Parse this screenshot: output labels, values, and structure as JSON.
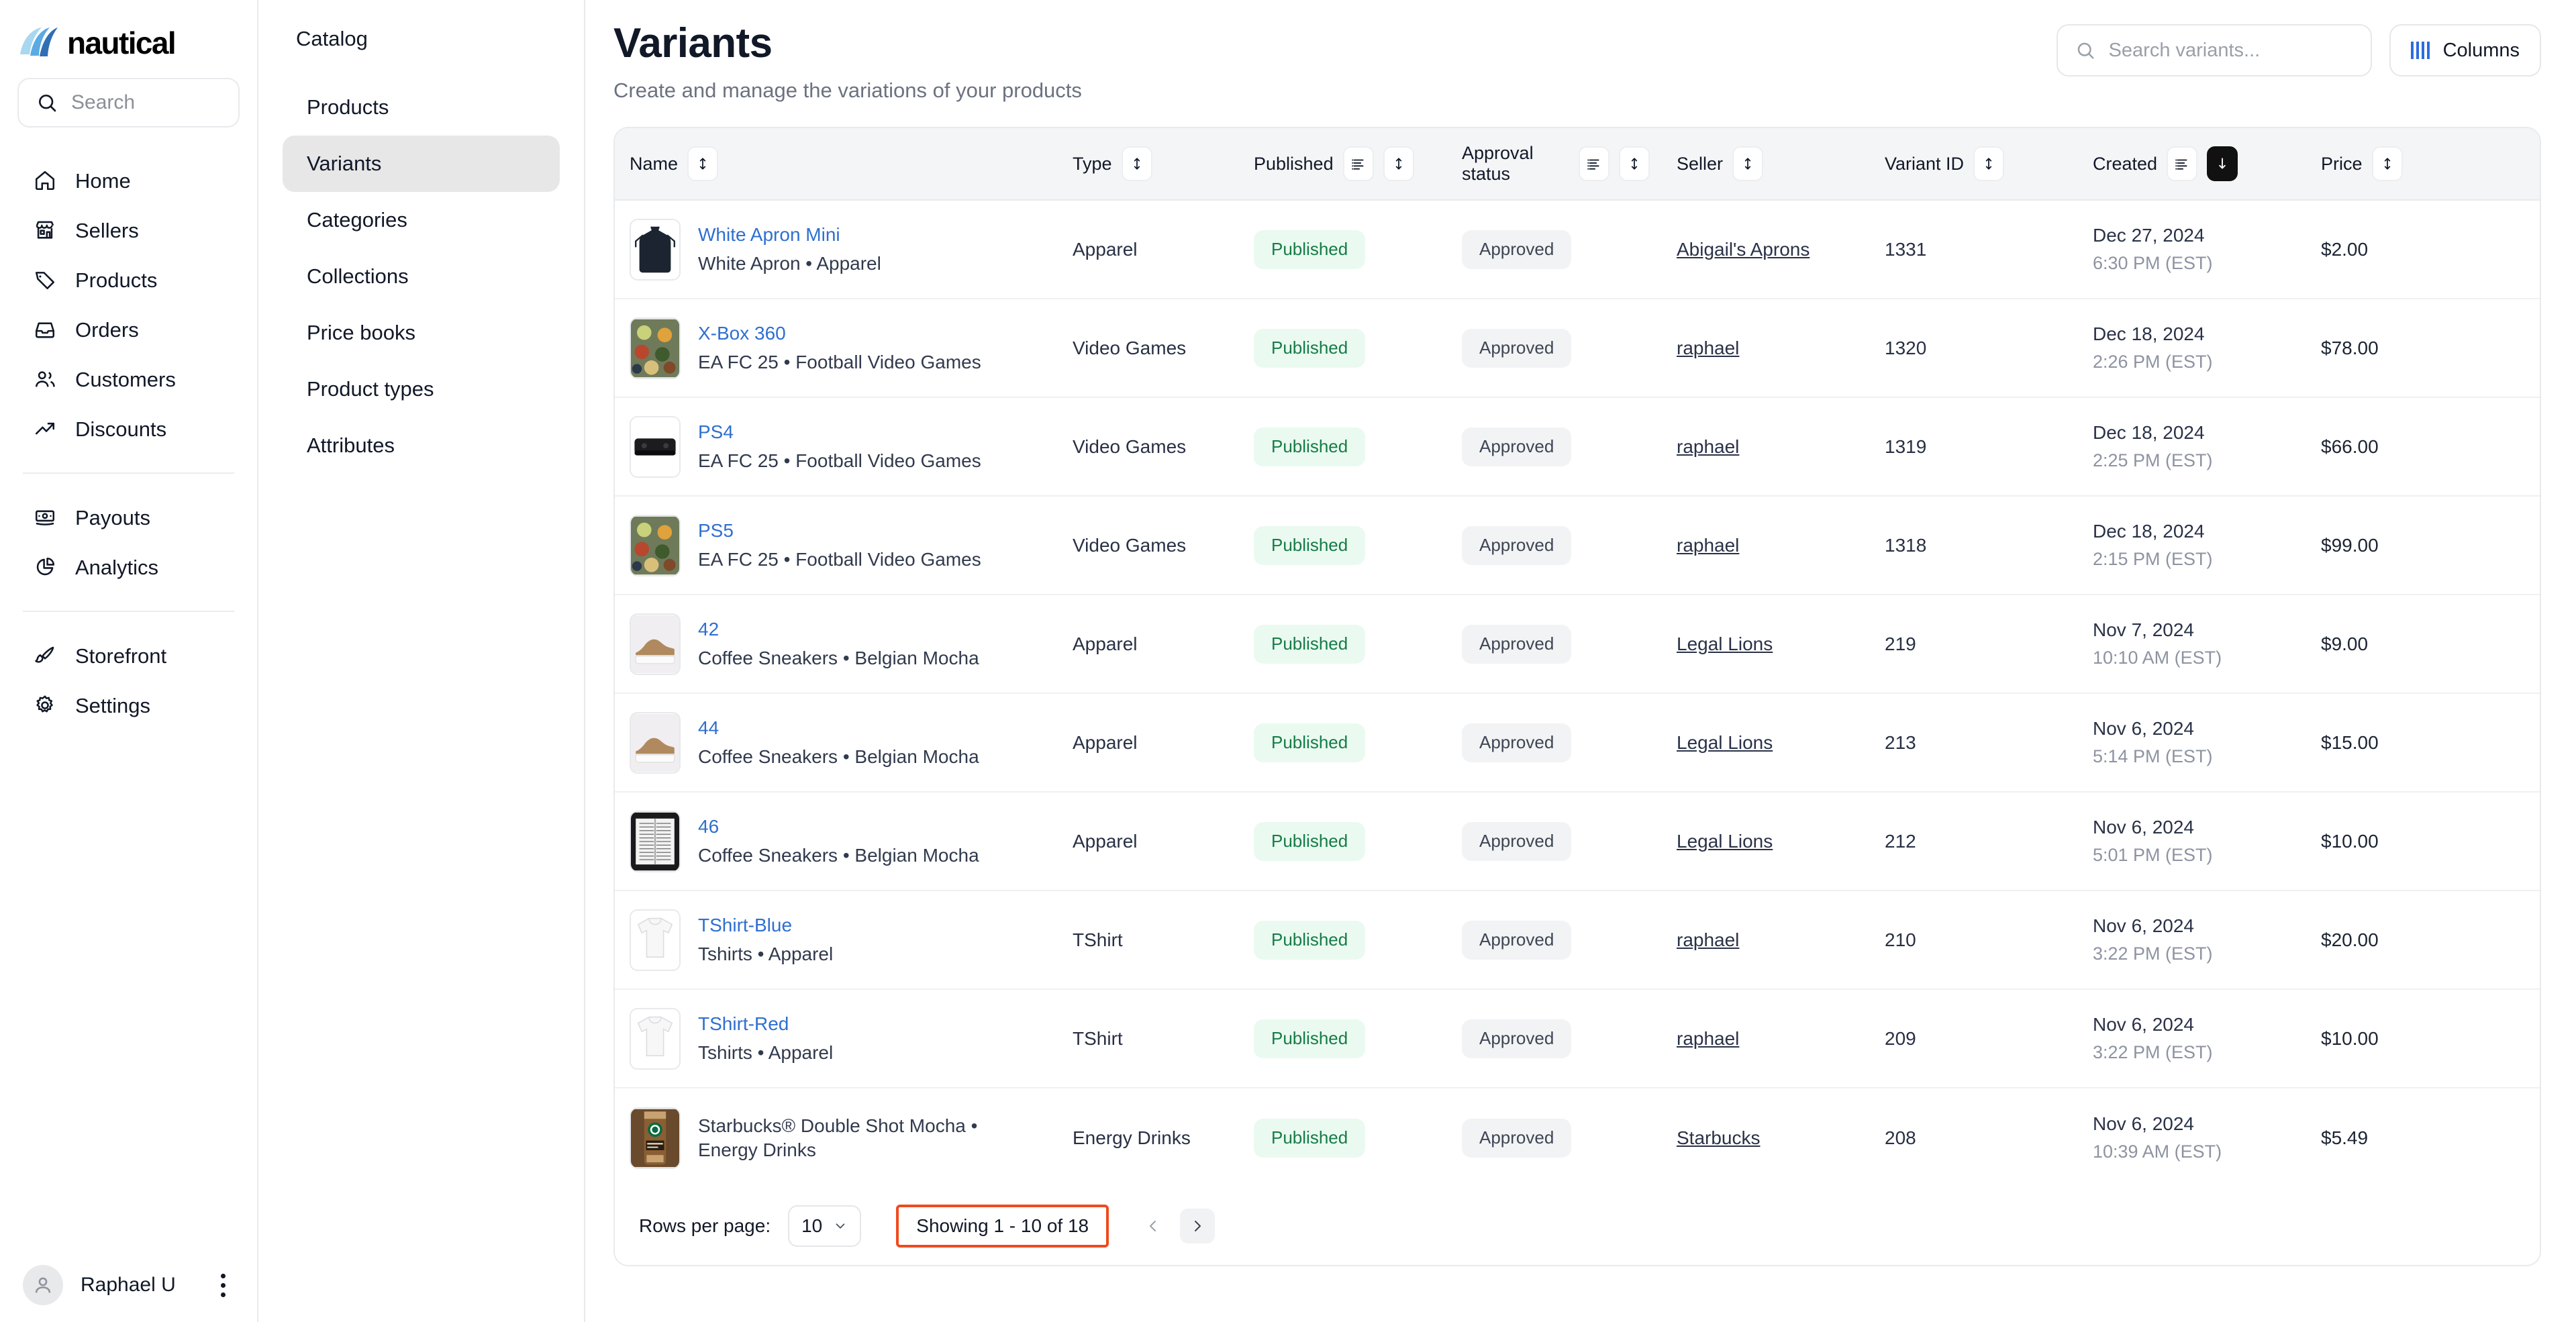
{
  "brand": {
    "name": "nautical"
  },
  "sidebar": {
    "search": {
      "placeholder": "Search"
    },
    "items": [
      {
        "label": "Home",
        "icon": "home-icon"
      },
      {
        "label": "Sellers",
        "icon": "store-icon"
      },
      {
        "label": "Products",
        "icon": "tag-icon"
      },
      {
        "label": "Orders",
        "icon": "inbox-icon"
      },
      {
        "label": "Customers",
        "icon": "users-icon"
      },
      {
        "label": "Discounts",
        "icon": "trending-up-icon"
      }
    ],
    "items2": [
      {
        "label": "Payouts",
        "icon": "banknote-icon"
      },
      {
        "label": "Analytics",
        "icon": "pie-chart-icon"
      }
    ],
    "items3": [
      {
        "label": "Storefront",
        "icon": "paintbrush-icon"
      },
      {
        "label": "Settings",
        "icon": "gear-icon"
      }
    ],
    "user": {
      "name": "Raphael U"
    }
  },
  "subnav": {
    "title": "Catalog",
    "items": [
      {
        "label": "Products",
        "active": false
      },
      {
        "label": "Variants",
        "active": true
      },
      {
        "label": "Categories",
        "active": false
      },
      {
        "label": "Collections",
        "active": false
      },
      {
        "label": "Price books",
        "active": false
      },
      {
        "label": "Product types",
        "active": false
      },
      {
        "label": "Attributes",
        "active": false
      }
    ]
  },
  "header": {
    "title": "Variants",
    "subtitle": "Create and manage the variations of your products",
    "search_placeholder": "Search variants...",
    "columns_label": "Columns"
  },
  "table": {
    "columns": [
      {
        "key": "name",
        "label": "Name",
        "has_filter": false,
        "has_sort": true,
        "sort_active": false
      },
      {
        "key": "type",
        "label": "Type",
        "has_filter": false,
        "has_sort": true,
        "sort_active": false
      },
      {
        "key": "published",
        "label": "Published",
        "has_filter": true,
        "has_sort": true,
        "sort_active": false
      },
      {
        "key": "approval_status",
        "label": "Approval status",
        "has_filter": true,
        "has_sort": true,
        "sort_active": false
      },
      {
        "key": "seller",
        "label": "Seller",
        "has_filter": false,
        "has_sort": true,
        "sort_active": false
      },
      {
        "key": "variant_id",
        "label": "Variant ID",
        "has_filter": false,
        "has_sort": true,
        "sort_active": false
      },
      {
        "key": "created",
        "label": "Created",
        "has_filter": true,
        "has_sort": true,
        "sort_active": true,
        "sort_dir": "desc"
      },
      {
        "key": "price",
        "label": "Price",
        "has_filter": false,
        "has_sort": true,
        "sort_active": false
      }
    ],
    "rows": [
      {
        "name": "White Apron Mini",
        "name_is_link": true,
        "subtitle": "White Apron • Apparel",
        "type": "Apparel",
        "published": "Published",
        "approval_status": "Approved",
        "seller": "Abigail's Aprons",
        "variant_id": "1331",
        "created_date": "Dec 27, 2024",
        "created_time": "6:30 PM (EST)",
        "price": "$2.00",
        "thumb": "apron"
      },
      {
        "name": "X-Box 360",
        "name_is_link": true,
        "subtitle": "EA FC 25 • Football Video Games",
        "type": "Video Games",
        "published": "Published",
        "approval_status": "Approved",
        "seller": "raphael",
        "variant_id": "1320",
        "created_date": "Dec 18, 2024",
        "created_time": "2:26 PM (EST)",
        "price": "$78.00",
        "thumb": "food"
      },
      {
        "name": "PS4",
        "name_is_link": true,
        "subtitle": "EA FC 25 • Football Video Games",
        "type": "Video Games",
        "published": "Published",
        "approval_status": "Approved",
        "seller": "raphael",
        "variant_id": "1319",
        "created_date": "Dec 18, 2024",
        "created_time": "2:25 PM (EST)",
        "price": "$66.00",
        "thumb": "console"
      },
      {
        "name": "PS5",
        "name_is_link": true,
        "subtitle": "EA FC 25 • Football Video Games",
        "type": "Video Games",
        "published": "Published",
        "approval_status": "Approved",
        "seller": "raphael",
        "variant_id": "1318",
        "created_date": "Dec 18, 2024",
        "created_time": "2:15 PM (EST)",
        "price": "$99.00",
        "thumb": "food"
      },
      {
        "name": "42",
        "name_is_link": true,
        "subtitle": "Coffee Sneakers • Belgian Mocha",
        "type": "Apparel",
        "published": "Published",
        "approval_status": "Approved",
        "seller": "Legal Lions",
        "variant_id": "219",
        "created_date": "Nov 7, 2024",
        "created_time": "10:10 AM (EST)",
        "price": "$9.00",
        "thumb": "shoe"
      },
      {
        "name": "44",
        "name_is_link": true,
        "subtitle": "Coffee Sneakers • Belgian Mocha",
        "type": "Apparel",
        "published": "Published",
        "approval_status": "Approved",
        "seller": "Legal Lions",
        "variant_id": "213",
        "created_date": "Nov 6, 2024",
        "created_time": "5:14 PM (EST)",
        "price": "$15.00",
        "thumb": "shoe"
      },
      {
        "name": "46",
        "name_is_link": true,
        "subtitle": "Coffee Sneakers • Belgian Mocha",
        "type": "Apparel",
        "published": "Published",
        "approval_status": "Approved",
        "seller": "Legal Lions",
        "variant_id": "212",
        "created_date": "Nov 6, 2024",
        "created_time": "5:01 PM (EST)",
        "price": "$10.00",
        "thumb": "book"
      },
      {
        "name": "TShirt-Blue",
        "name_is_link": true,
        "subtitle": "Tshirts • Apparel",
        "type": "TShirt",
        "published": "Published",
        "approval_status": "Approved",
        "seller": "raphael",
        "variant_id": "210",
        "created_date": "Nov 6, 2024",
        "created_time": "3:22 PM (EST)",
        "price": "$20.00",
        "thumb": "tshirt"
      },
      {
        "name": "TShirt-Red",
        "name_is_link": true,
        "subtitle": "Tshirts • Apparel",
        "type": "TShirt",
        "published": "Published",
        "approval_status": "Approved",
        "seller": "raphael",
        "variant_id": "209",
        "created_date": "Nov 6, 2024",
        "created_time": "3:22 PM (EST)",
        "price": "$10.00",
        "thumb": "tshirt"
      },
      {
        "name": "Starbucks® Double Shot Mocha • Energy Drinks",
        "name_is_link": false,
        "subtitle": "",
        "type": "Energy Drinks",
        "published": "Published",
        "approval_status": "Approved",
        "seller": "Starbucks",
        "variant_id": "208",
        "created_date": "Nov 6, 2024",
        "created_time": "10:39 AM (EST)",
        "price": "$5.49",
        "thumb": "can"
      }
    ]
  },
  "footer": {
    "rows_per_page_label": "Rows per page:",
    "rows_per_page_value": "10",
    "showing_text": "Showing 1 - 10 of 18",
    "highlight_color": "#f04a1f"
  }
}
